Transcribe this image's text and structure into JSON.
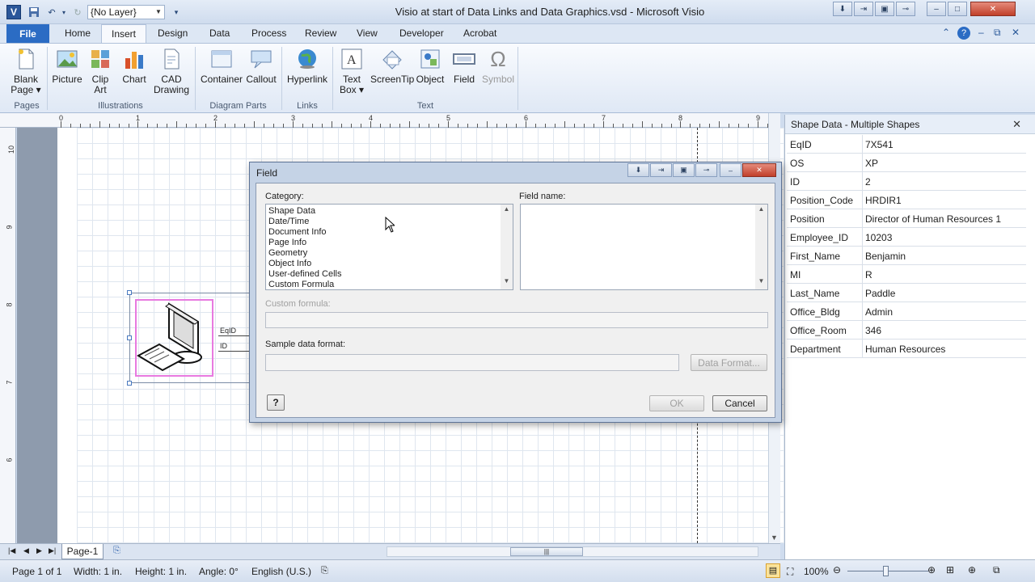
{
  "window": {
    "title": "Visio at start of Data Links and Data Graphics.vsd - Microsoft Visio",
    "app_icon": "V",
    "layer_dropdown": "{No Layer}"
  },
  "tabs": [
    "File",
    "Home",
    "Insert",
    "Design",
    "Data",
    "Process",
    "Review",
    "View",
    "Developer",
    "Acrobat"
  ],
  "ribbon": {
    "pages": {
      "group": "Pages",
      "blank_page": "Blank\nPage ▾"
    },
    "illustrations": {
      "group": "Illustrations",
      "picture": "Picture",
      "clip_art": "Clip\nArt",
      "chart": "Chart",
      "cad": "CAD\nDrawing"
    },
    "diagram_parts": {
      "group": "Diagram Parts",
      "container": "Container",
      "callout": "Callout"
    },
    "links": {
      "group": "Links",
      "hyperlink": "Hyperlink"
    },
    "text": {
      "group": "Text",
      "text_box": "Text\nBox ▾",
      "screentip": "ScreenTip",
      "object": "Object",
      "field": "Field",
      "symbol": "Symbol"
    }
  },
  "ruler": {
    "h_ticks": [
      "0",
      "1",
      "2",
      "3",
      "4",
      "5",
      "6",
      "7",
      "8",
      "9"
    ],
    "v_ticks": [
      "10",
      "9",
      "8",
      "7",
      "6"
    ]
  },
  "shape": {
    "label_1": "EqID",
    "label_2": "ID"
  },
  "dialog": {
    "title": "Field",
    "category_label": "Category:",
    "field_name_label": "Field name:",
    "categories": [
      "Shape Data",
      "Date/Time",
      "Document Info",
      "Page Info",
      "Geometry",
      "Object Info",
      "User-defined Cells",
      "Custom Formula"
    ],
    "custom_formula_label": "Custom formula:",
    "sample_format_label": "Sample data format:",
    "data_format_button": "Data Format...",
    "ok_button": "OK",
    "cancel_button": "Cancel"
  },
  "shape_data_panel": {
    "title": "Shape Data - Multiple Shapes",
    "rows": [
      {
        "key": "EqID",
        "value": "7X541"
      },
      {
        "key": "OS",
        "value": "XP"
      },
      {
        "key": "ID",
        "value": "2"
      },
      {
        "key": "Position_Code",
        "value": "HRDIR1"
      },
      {
        "key": "Position",
        "value": "Director of Human Resources 1"
      },
      {
        "key": "Employee_ID",
        "value": "10203"
      },
      {
        "key": "First_Name",
        "value": "Benjamin"
      },
      {
        "key": "MI",
        "value": "R"
      },
      {
        "key": "Last_Name",
        "value": "Paddle"
      },
      {
        "key": "Office_Bldg",
        "value": "Admin"
      },
      {
        "key": "Office_Room",
        "value": "346"
      },
      {
        "key": "Department",
        "value": "Human Resources"
      }
    ]
  },
  "page_tab": "Page-1",
  "status": {
    "page": "Page 1 of 1",
    "width": "Width: 1 in.",
    "height": "Height: 1 in.",
    "angle": "Angle: 0°",
    "language": "English (U.S.)",
    "zoom": "100%"
  }
}
